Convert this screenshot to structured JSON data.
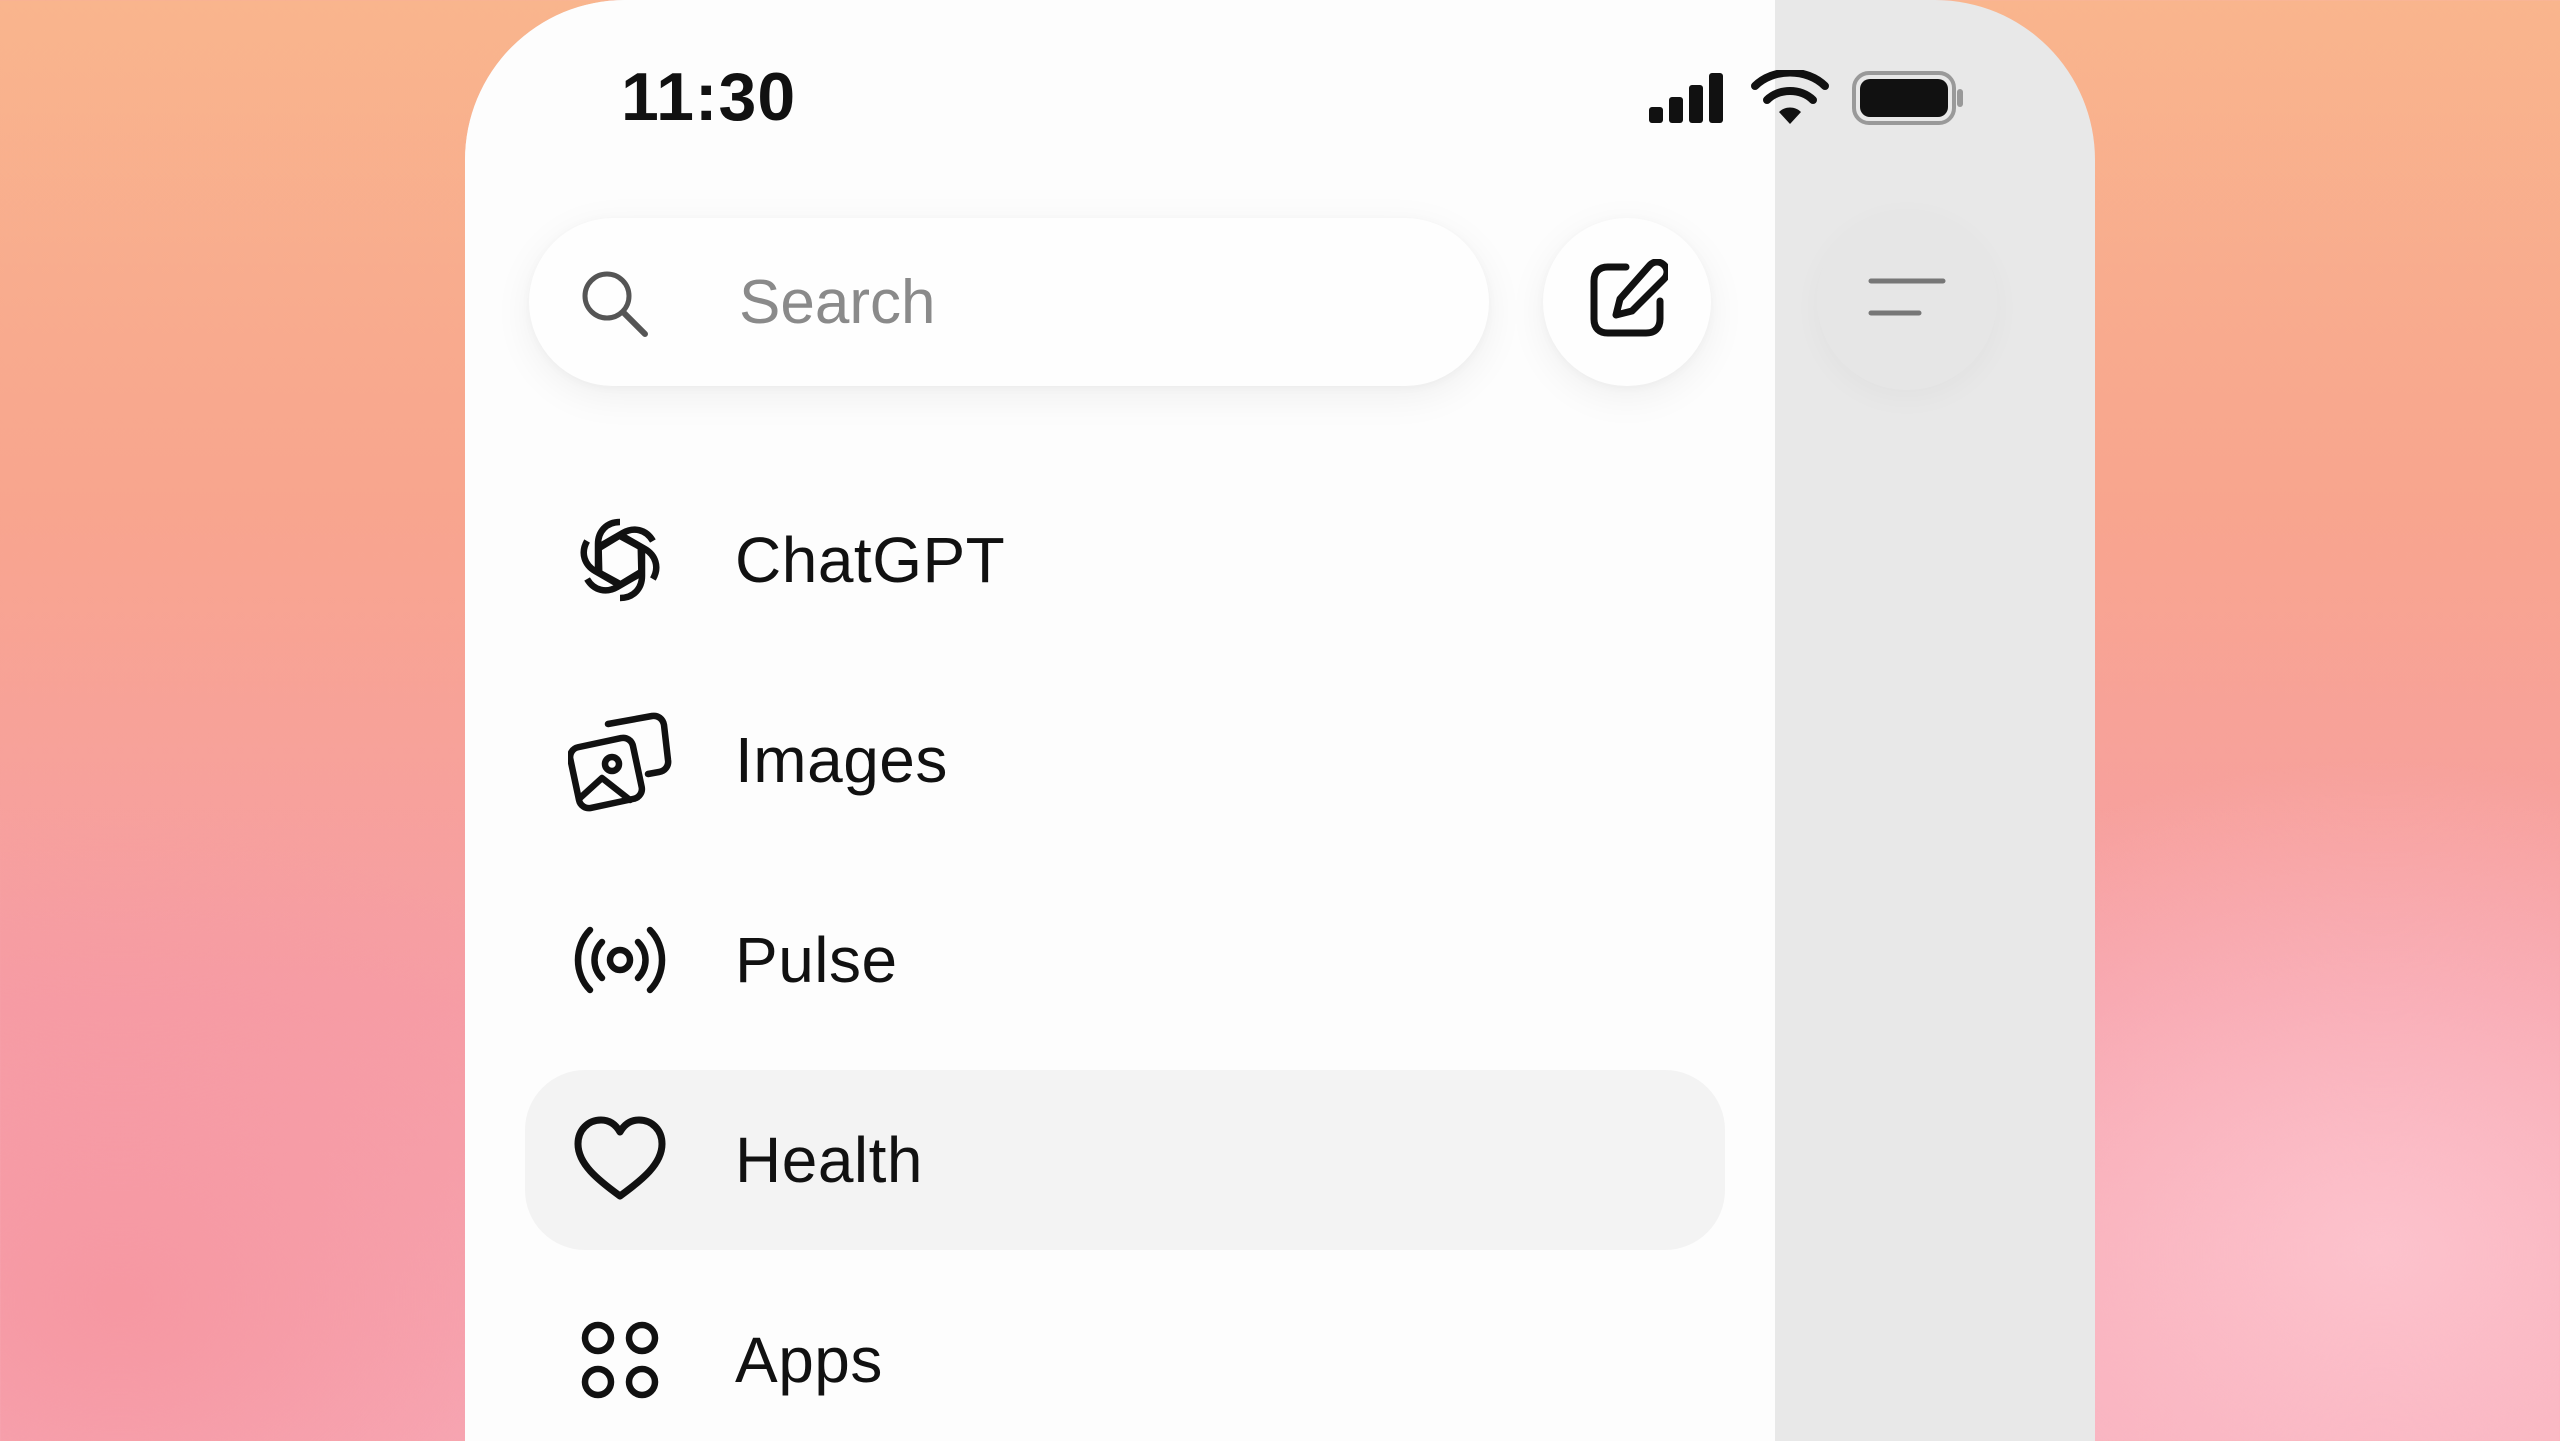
{
  "status_bar": {
    "time": "11:30",
    "icons": [
      "cellular-signal-icon",
      "wifi-icon",
      "battery-icon"
    ]
  },
  "search": {
    "placeholder": "Search",
    "value": "",
    "icon": "search-icon"
  },
  "toolbar": {
    "compose_icon": "compose-icon",
    "menu_icon": "menu-icon"
  },
  "nav": {
    "items": [
      {
        "label": "ChatGPT",
        "icon": "openai-logo-icon",
        "selected": false
      },
      {
        "label": "Images",
        "icon": "images-icon",
        "selected": false
      },
      {
        "label": "Pulse",
        "icon": "pulse-icon",
        "selected": false
      },
      {
        "label": "Health",
        "icon": "heart-icon",
        "selected": true
      },
      {
        "label": "Apps",
        "icon": "apps-grid-icon",
        "selected": false
      }
    ]
  },
  "colors": {
    "drawer_background": "#fdfdfd",
    "main_panel_background": "#e8e8e8",
    "selected_item_background": "#f3f3f3",
    "text": "#111111",
    "placeholder_text": "#8a8a8a"
  }
}
